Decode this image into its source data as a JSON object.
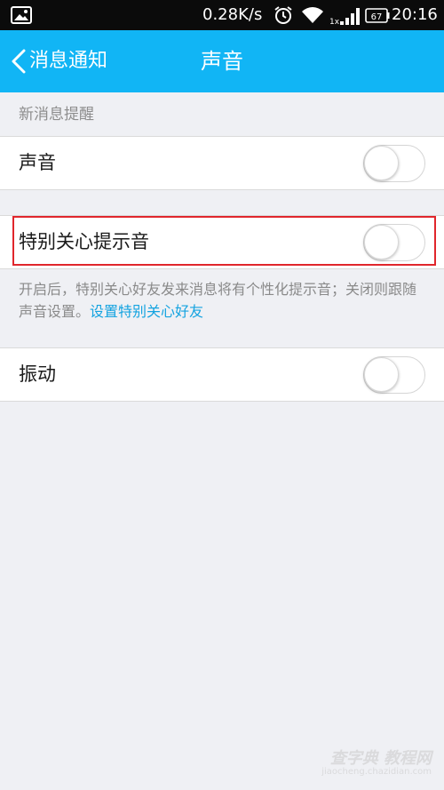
{
  "status_bar": {
    "net_speed": "0.28K/s",
    "battery": "67",
    "signal_label": "1x",
    "time": "20:16",
    "icons": [
      "gallery-icon",
      "alarm-icon",
      "wifi-icon",
      "signal-icon",
      "battery-icon"
    ]
  },
  "title_bar": {
    "back_label": "消息通知",
    "title": "声音",
    "background": "#11b5f5"
  },
  "section": {
    "header": "新消息提醒"
  },
  "rows": [
    {
      "label": "声音",
      "enabled": false
    },
    {
      "label": "特别关心提示音",
      "enabled": false
    },
    {
      "label": "振动",
      "enabled": false
    }
  ],
  "description": {
    "text": "开启后，特别关心好友发来消息将有个性化提示音；关闭则跟随声音设置。",
    "link": "设置特别关心好友",
    "link_color": "#14a3e0"
  },
  "highlight_color": "#e0262c",
  "watermark": {
    "main": "查字典 教程网",
    "sub": "jiaocheng.chazidian.com"
  }
}
